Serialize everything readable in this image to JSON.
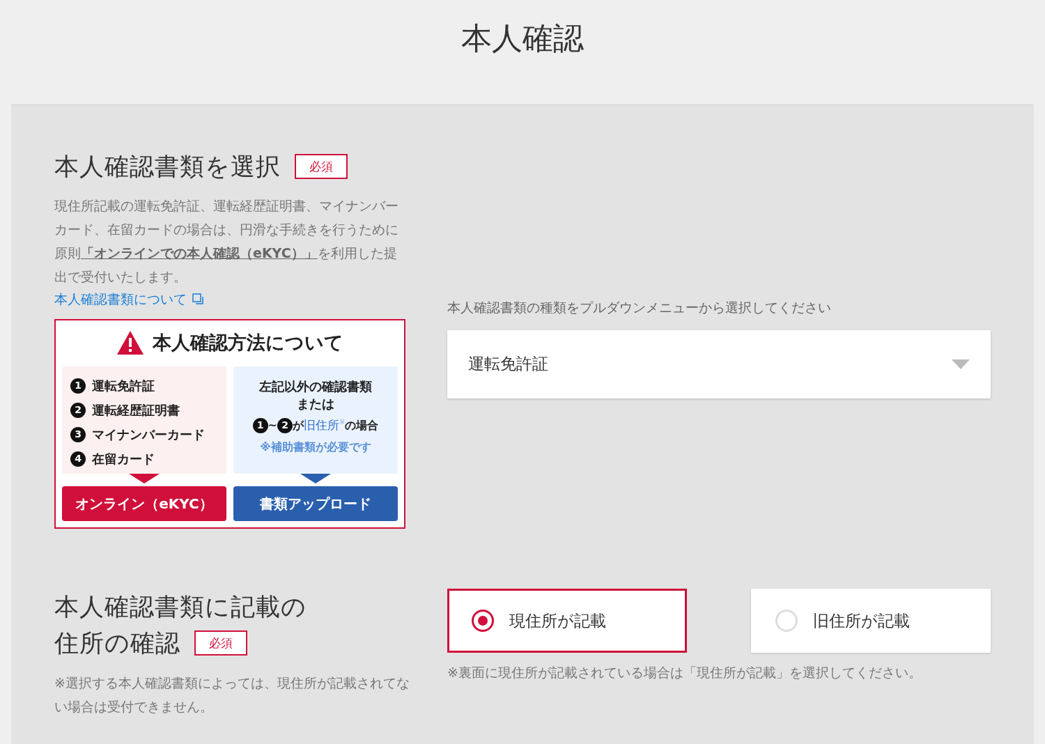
{
  "page_title": "本人確認",
  "document_section": {
    "heading": "本人確認書類を選択",
    "required_badge": "必須",
    "description": "現住所記載の運転免許証、運転経歴証明書、マイナンバーカード、在留カードの場合は、円滑な手続きを行うために原則**「オンラインでの本人確認（eKYC）」**を利用した提出で受付いたします。",
    "link": "本人確認書類について",
    "infographic": {
      "title": "本人確認方法について",
      "left_items": [
        {
          "number": "1",
          "label": "運転免許証"
        },
        {
          "number": "2",
          "label": "運転経歴証明書"
        },
        {
          "number": "3",
          "label": "マイナンバーカード"
        },
        {
          "number": "4",
          "label": "在留カード"
        }
      ],
      "right_lines": [
        "左記以外の確認書類",
        "または"
      ],
      "right_condition": [
        {
          "kind": "number",
          "text": "1"
        },
        {
          "kind": "text",
          "text": "~"
        },
        {
          "kind": "number",
          "text": "2"
        },
        {
          "kind": "text",
          "text": "が"
        },
        {
          "kind": "accent",
          "text": "旧住所"
        },
        {
          "kind": "sup",
          "text": "※"
        },
        {
          "kind": "text",
          "text": "の場合"
        }
      ],
      "right_note": "※補助書類が必要です",
      "left_button": "オンライン（eKYC）",
      "right_button": "書類アップロード"
    },
    "select_label": "本人確認書類の種類をプルダウンメニューから選択してください",
    "select_value": "運転免許証"
  },
  "address_section": {
    "heading_lines": [
      "本人確認書類に記載の",
      "住所の確認"
    ],
    "required_badge": "必須",
    "note": "※選択する本人確認書類によっては、現住所が記載されてない場合は受付できません。",
    "options": [
      {
        "label": "現住所が記載",
        "selected": true
      },
      {
        "label": "旧住所が記載",
        "selected": false
      }
    ],
    "option_note": "※裏面に現住所が記載されている場合は「現住所が記載」を選択してください。"
  }
}
